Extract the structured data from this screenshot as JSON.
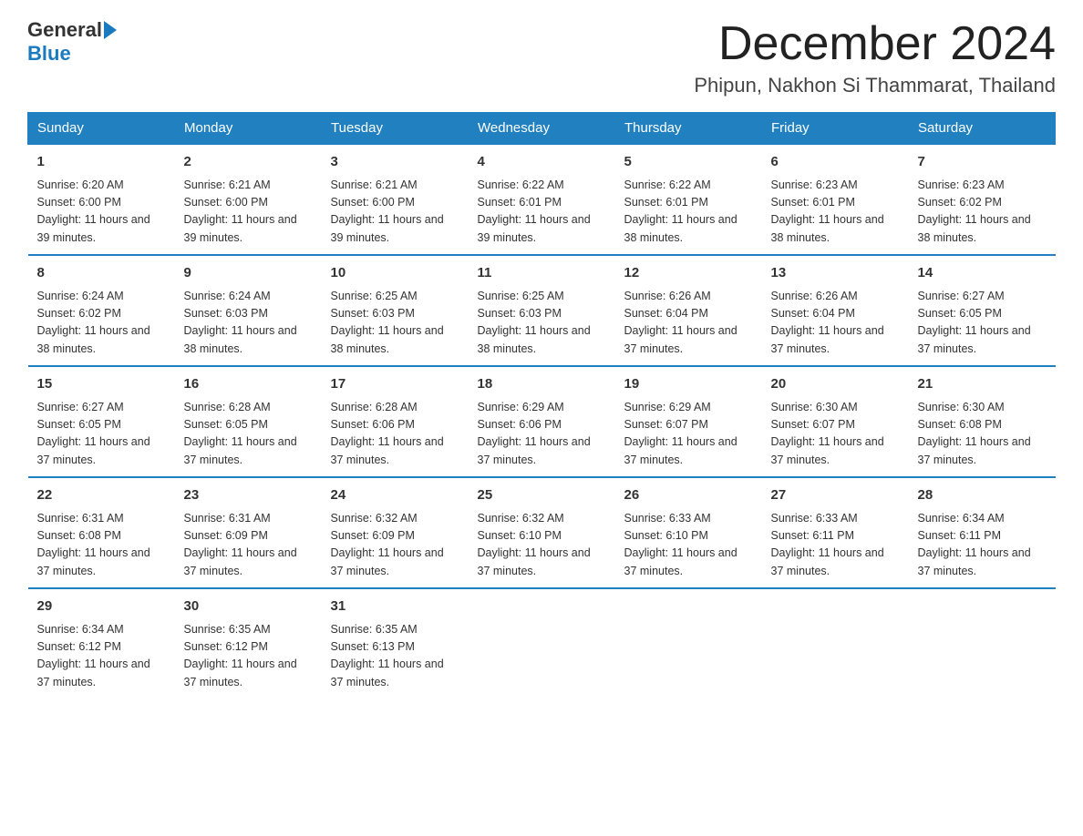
{
  "logo": {
    "general": "General",
    "blue": "Blue"
  },
  "title": "December 2024",
  "location": "Phipun, Nakhon Si Thammarat, Thailand",
  "days_of_week": [
    "Sunday",
    "Monday",
    "Tuesday",
    "Wednesday",
    "Thursday",
    "Friday",
    "Saturday"
  ],
  "weeks": [
    [
      {
        "day": "1",
        "sunrise": "6:20 AM",
        "sunset": "6:00 PM",
        "daylight": "11 hours and 39 minutes."
      },
      {
        "day": "2",
        "sunrise": "6:21 AM",
        "sunset": "6:00 PM",
        "daylight": "11 hours and 39 minutes."
      },
      {
        "day": "3",
        "sunrise": "6:21 AM",
        "sunset": "6:00 PM",
        "daylight": "11 hours and 39 minutes."
      },
      {
        "day": "4",
        "sunrise": "6:22 AM",
        "sunset": "6:01 PM",
        "daylight": "11 hours and 39 minutes."
      },
      {
        "day": "5",
        "sunrise": "6:22 AM",
        "sunset": "6:01 PM",
        "daylight": "11 hours and 38 minutes."
      },
      {
        "day": "6",
        "sunrise": "6:23 AM",
        "sunset": "6:01 PM",
        "daylight": "11 hours and 38 minutes."
      },
      {
        "day": "7",
        "sunrise": "6:23 AM",
        "sunset": "6:02 PM",
        "daylight": "11 hours and 38 minutes."
      }
    ],
    [
      {
        "day": "8",
        "sunrise": "6:24 AM",
        "sunset": "6:02 PM",
        "daylight": "11 hours and 38 minutes."
      },
      {
        "day": "9",
        "sunrise": "6:24 AM",
        "sunset": "6:03 PM",
        "daylight": "11 hours and 38 minutes."
      },
      {
        "day": "10",
        "sunrise": "6:25 AM",
        "sunset": "6:03 PM",
        "daylight": "11 hours and 38 minutes."
      },
      {
        "day": "11",
        "sunrise": "6:25 AM",
        "sunset": "6:03 PM",
        "daylight": "11 hours and 38 minutes."
      },
      {
        "day": "12",
        "sunrise": "6:26 AM",
        "sunset": "6:04 PM",
        "daylight": "11 hours and 37 minutes."
      },
      {
        "day": "13",
        "sunrise": "6:26 AM",
        "sunset": "6:04 PM",
        "daylight": "11 hours and 37 minutes."
      },
      {
        "day": "14",
        "sunrise": "6:27 AM",
        "sunset": "6:05 PM",
        "daylight": "11 hours and 37 minutes."
      }
    ],
    [
      {
        "day": "15",
        "sunrise": "6:27 AM",
        "sunset": "6:05 PM",
        "daylight": "11 hours and 37 minutes."
      },
      {
        "day": "16",
        "sunrise": "6:28 AM",
        "sunset": "6:05 PM",
        "daylight": "11 hours and 37 minutes."
      },
      {
        "day": "17",
        "sunrise": "6:28 AM",
        "sunset": "6:06 PM",
        "daylight": "11 hours and 37 minutes."
      },
      {
        "day": "18",
        "sunrise": "6:29 AM",
        "sunset": "6:06 PM",
        "daylight": "11 hours and 37 minutes."
      },
      {
        "day": "19",
        "sunrise": "6:29 AM",
        "sunset": "6:07 PM",
        "daylight": "11 hours and 37 minutes."
      },
      {
        "day": "20",
        "sunrise": "6:30 AM",
        "sunset": "6:07 PM",
        "daylight": "11 hours and 37 minutes."
      },
      {
        "day": "21",
        "sunrise": "6:30 AM",
        "sunset": "6:08 PM",
        "daylight": "11 hours and 37 minutes."
      }
    ],
    [
      {
        "day": "22",
        "sunrise": "6:31 AM",
        "sunset": "6:08 PM",
        "daylight": "11 hours and 37 minutes."
      },
      {
        "day": "23",
        "sunrise": "6:31 AM",
        "sunset": "6:09 PM",
        "daylight": "11 hours and 37 minutes."
      },
      {
        "day": "24",
        "sunrise": "6:32 AM",
        "sunset": "6:09 PM",
        "daylight": "11 hours and 37 minutes."
      },
      {
        "day": "25",
        "sunrise": "6:32 AM",
        "sunset": "6:10 PM",
        "daylight": "11 hours and 37 minutes."
      },
      {
        "day": "26",
        "sunrise": "6:33 AM",
        "sunset": "6:10 PM",
        "daylight": "11 hours and 37 minutes."
      },
      {
        "day": "27",
        "sunrise": "6:33 AM",
        "sunset": "6:11 PM",
        "daylight": "11 hours and 37 minutes."
      },
      {
        "day": "28",
        "sunrise": "6:34 AM",
        "sunset": "6:11 PM",
        "daylight": "11 hours and 37 minutes."
      }
    ],
    [
      {
        "day": "29",
        "sunrise": "6:34 AM",
        "sunset": "6:12 PM",
        "daylight": "11 hours and 37 minutes."
      },
      {
        "day": "30",
        "sunrise": "6:35 AM",
        "sunset": "6:12 PM",
        "daylight": "11 hours and 37 minutes."
      },
      {
        "day": "31",
        "sunrise": "6:35 AM",
        "sunset": "6:13 PM",
        "daylight": "11 hours and 37 minutes."
      },
      null,
      null,
      null,
      null
    ]
  ]
}
